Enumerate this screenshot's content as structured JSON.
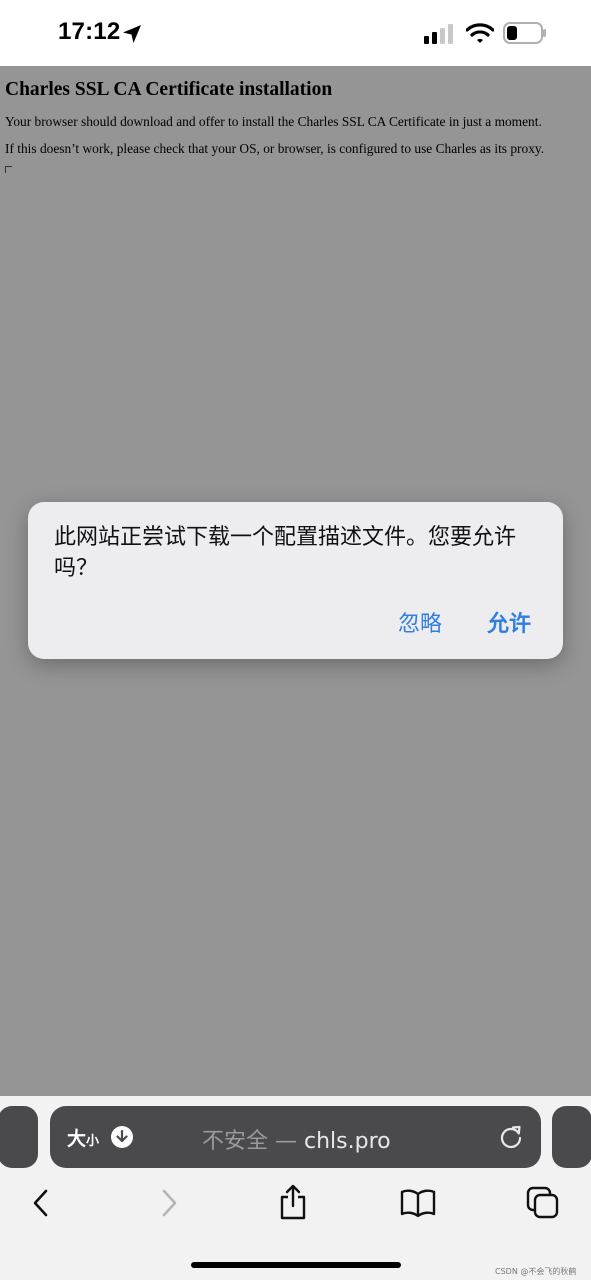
{
  "status_bar": {
    "time": "17:12",
    "icons": [
      "location-arrow-icon",
      "cellular-signal-icon",
      "wifi-icon",
      "battery-icon"
    ]
  },
  "page": {
    "title": "Charles SSL CA Certificate installation",
    "paragraphs": [
      "Your browser should download and offer to install the Charles SSL CA Certificate in just a moment.",
      "If this doesn’t work, please check that your OS, or browser, is configured to use Charles as its proxy."
    ]
  },
  "alert": {
    "message": "此网站正尝试下载一个配置描述文件。您要允许吗？",
    "ignore_label": "忽略",
    "allow_label": "允许",
    "accent_color": "#2f7ee0"
  },
  "address_bar": {
    "size_label_big": "大",
    "size_label_small": "小",
    "insecure_label": "不安全",
    "separator": "—",
    "domain": "chls.pro"
  },
  "toolbar": {
    "icons": [
      "back-icon",
      "forward-icon",
      "share-icon",
      "bookmarks-icon",
      "tabs-icon"
    ]
  },
  "watermark": "CSDN @不会飞的秋鹤"
}
